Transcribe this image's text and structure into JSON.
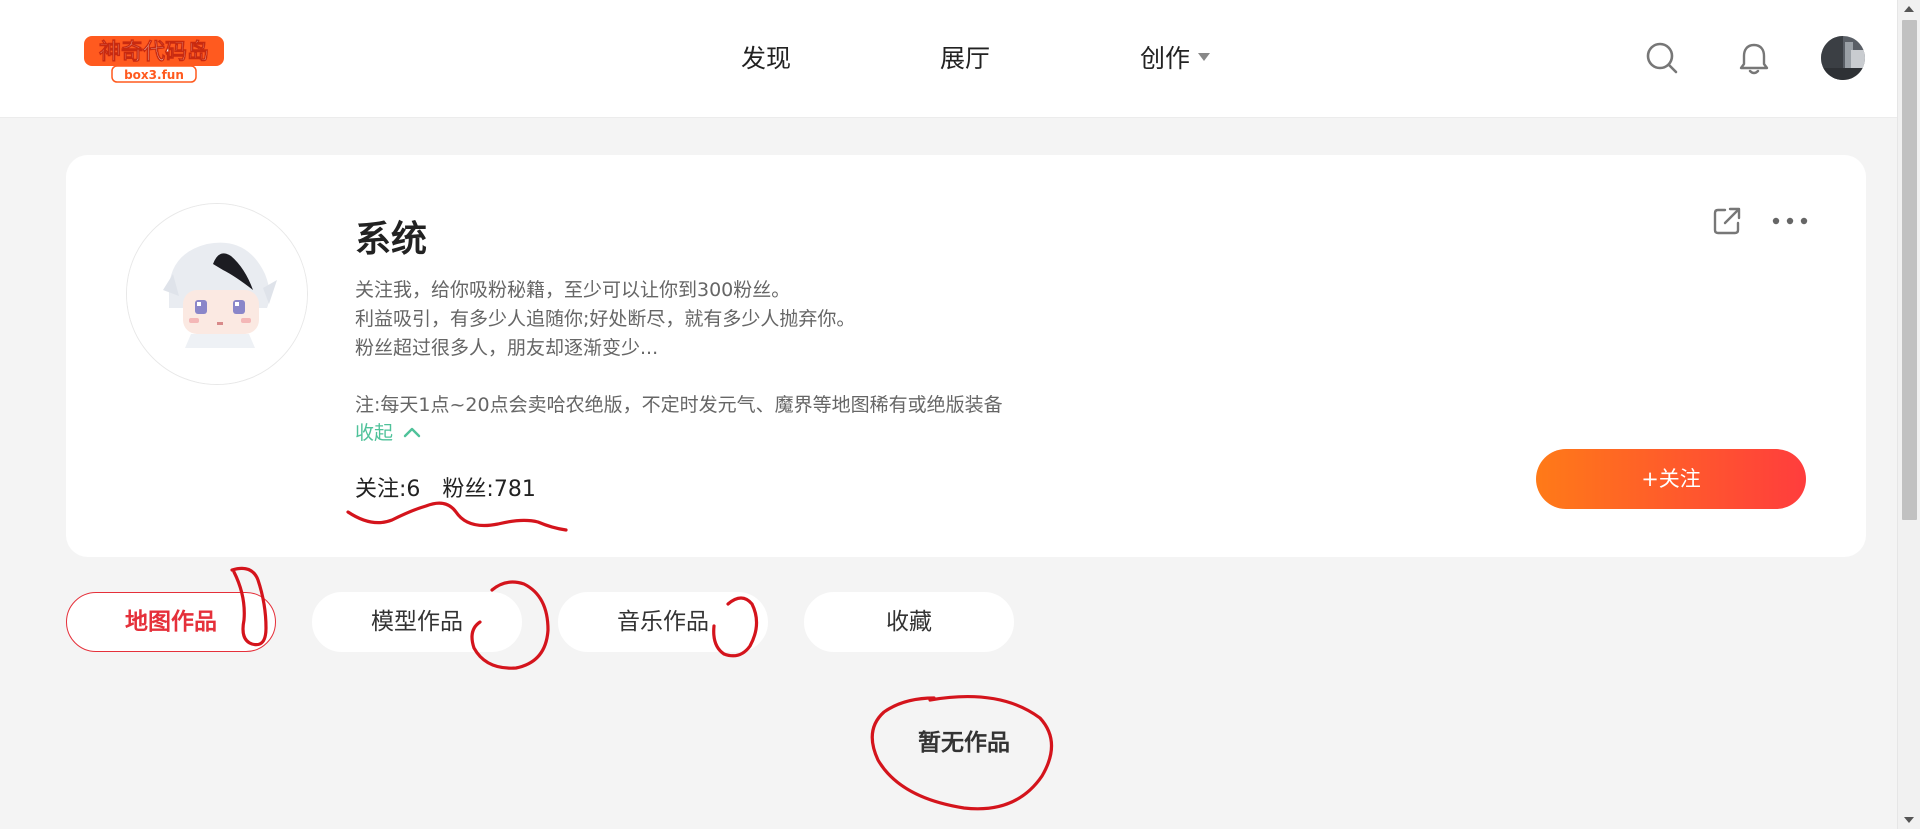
{
  "header": {
    "logo_text": "神奇代码岛",
    "logo_subtext": "box3.fun",
    "nav": [
      {
        "label": "发现"
      },
      {
        "label": "展厅"
      },
      {
        "label": "创作"
      }
    ]
  },
  "profile": {
    "name": "系统",
    "bio_lines": [
      "关注我，给你吸粉秘籍，至少可以让你到300粉丝。",
      "利益吸引，有多少人追随你;好处断尽，就有多少人抛弃你。",
      "粉丝超过很多人，朋友却逐渐变少...",
      "",
      "注:每天1点~20点会卖哈农绝版，不定时发元气、魔界等地图稀有或绝版装备"
    ],
    "collapse_label": "收起",
    "following_label": "关注:6",
    "fans_label": "粉丝:781",
    "follow_button": "+关注"
  },
  "tabs": [
    {
      "label": "地图作品",
      "active": true
    },
    {
      "label": "模型作品",
      "active": false
    },
    {
      "label": "音乐作品",
      "active": false
    },
    {
      "label": "收藏",
      "active": false
    }
  ],
  "empty_state": "暂无作品",
  "colors": {
    "accent_red": "#e5303a",
    "follow_gradient_start": "#ff7a18",
    "follow_gradient_end": "#ff3d3d",
    "collapse_green": "#4fc29a",
    "annotation_red": "#d4141c"
  }
}
